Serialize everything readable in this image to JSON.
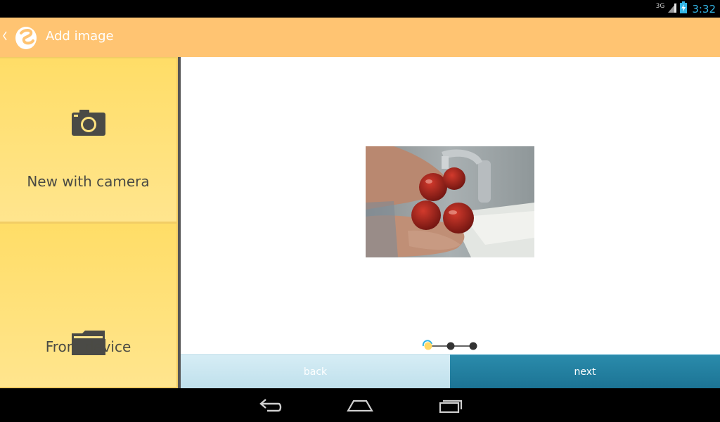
{
  "status_bar": {
    "network_type": "3G",
    "time": "3:32",
    "icons": [
      "signal-icon",
      "battery-charging-icon"
    ]
  },
  "action_bar": {
    "title": "Add image",
    "background": "#ffc472",
    "icons": [
      "back-caret-icon",
      "app-logo-icon"
    ]
  },
  "options": [
    {
      "label": "New with camera",
      "icon": "camera-icon"
    },
    {
      "label": "From device",
      "icon": "folder-icon"
    }
  ],
  "preview": {
    "description_icon": "image-preview"
  },
  "pager": {
    "total_steps": 3,
    "current_step": 1
  },
  "buttons": {
    "back_label": "back",
    "next_label": "next",
    "next_color": "#1c7495",
    "back_color": "#c8e6f0"
  },
  "nav_bar": {
    "icons": [
      "nav-back-icon",
      "nav-home-icon",
      "nav-recents-icon"
    ]
  }
}
